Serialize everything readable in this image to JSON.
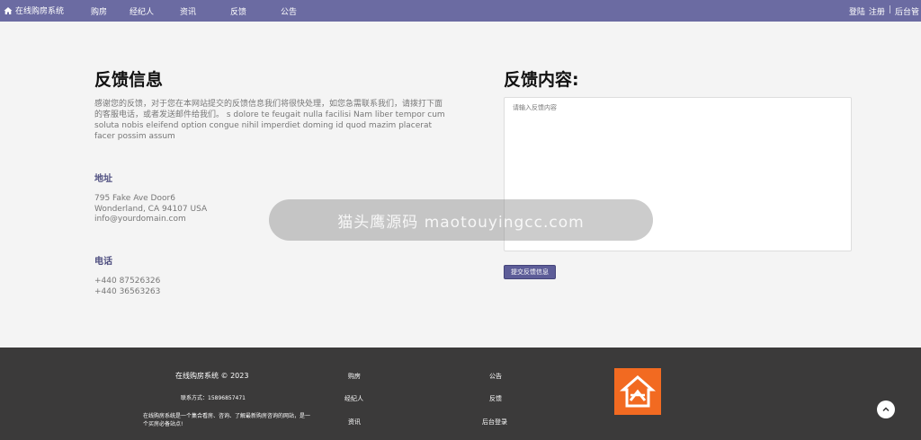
{
  "topnav": {
    "brand": "在线购房系统",
    "links": [
      "购房",
      "经纪人",
      "资讯",
      "反馈",
      "公告"
    ],
    "login": "登陆",
    "register": "注册",
    "separator": "|",
    "admin": "后台管"
  },
  "main": {
    "left_title": "反馈信息",
    "right_title": "反馈内容:",
    "intro": "感谢您的反馈，对于您在本网站提交的反馈信息我们将很快处理，如您急需联系我们，请拨打下面的客服电话，或者发送邮件给我们。 s dolore te feugait nulla facilisi Nam liber tempor cum soluta nobis eleifend option congue nihil imperdiet doming id quod mazim placerat facer possim assum",
    "address_title": "地址",
    "address_lines": [
      "795 Fake Ave Door6",
      "Wonderland, CA 94107 USA",
      "info@yourdomain.com"
    ],
    "phone_title": "电话",
    "phone_lines": [
      "+440 87526326",
      "+440 36563263"
    ],
    "feedback_placeholder": "请输入反馈内容",
    "submit_label": "提交反馈信息"
  },
  "watermark": "猫头鹰源码 maotouyingcc.com",
  "footer": {
    "copyright": "在线购房系统 © 2023",
    "contact": "联系方式：15896857471",
    "description": "在线购房系统是一个集合看房、咨询、了解最新购房咨询的网站，是一个买房必备站点!",
    "links_col1": [
      "购房",
      "经纪人",
      "资讯"
    ],
    "links_col2": [
      "公告",
      "反馈",
      "后台登录"
    ]
  },
  "colors": {
    "nav_bg": "#6b6ba2",
    "footer_bg": "#3b3a3a",
    "logo_bg": "#f26a21",
    "button_bg": "#5d5d98"
  }
}
